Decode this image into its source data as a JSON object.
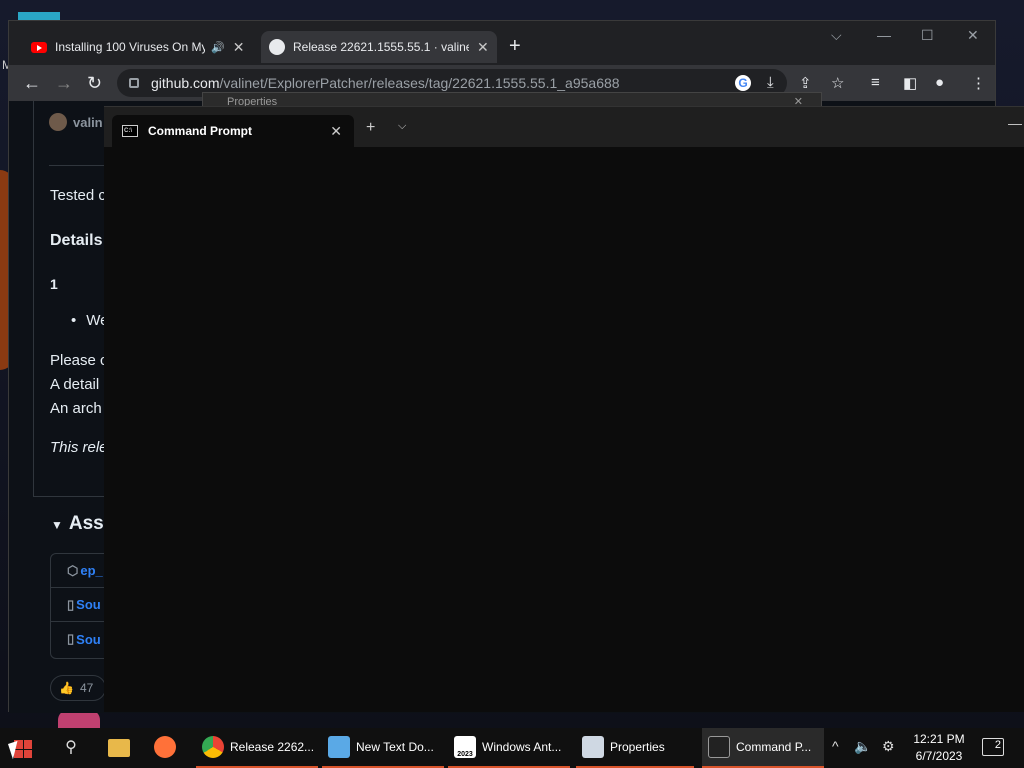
{
  "desktop": {
    "side_letter": "M"
  },
  "browser": {
    "tabs": [
      {
        "title": "Installing 100 Viruses On My",
        "icon": "youtube-icon",
        "audio": "🔊"
      },
      {
        "title": "Release 22621.1555.55.1 · valinet/",
        "icon": "github-icon"
      }
    ],
    "url_host": "github.com",
    "url_path": "/valinet/ExplorerPatcher/releases/tag/22621.1555.55.1_a95a688",
    "controls": {
      "dropdown": "⌵",
      "minimize": "—",
      "maximize": "☐",
      "close": "✕",
      "new_tab": "+",
      "tab_close": "✕"
    }
  },
  "release_page": {
    "author": "valin",
    "tested": "Tested c",
    "details": "Details",
    "item_num": "1",
    "bullet_text": "We",
    "please": "Please c",
    "detail": "A detail",
    "archive": "An arch",
    "note": "This rele",
    "assets_heading": "Asse",
    "assets": [
      {
        "icon": "package-icon",
        "name": "ep_"
      },
      {
        "icon": "zip-icon",
        "name": "Sou"
      },
      {
        "icon": "zip-icon",
        "name": "Sou"
      }
    ],
    "reaction_count": "47"
  },
  "properties_window": {
    "title": "Properties"
  },
  "terminal": {
    "tab_title": "Command Prompt",
    "tab_icon_text": "C:\\",
    "new_tab": "+",
    "dropdown": "⌵",
    "minimize": "—",
    "close": "✕"
  },
  "taskbar": {
    "apps": [
      {
        "label": "Release 2262...",
        "icon": "chrome-icon"
      },
      {
        "label": "New Text Do...",
        "icon": "notepad-icon"
      },
      {
        "label": "Windows Ant...",
        "icon": "app-2023-icon",
        "icon_text": "2023"
      },
      {
        "label": "Properties",
        "icon": "properties-icon"
      },
      {
        "label": "Command P...",
        "icon": "terminal-icon"
      }
    ],
    "time": "12:21 PM",
    "date": "6/7/2023",
    "notification_count": "2"
  }
}
